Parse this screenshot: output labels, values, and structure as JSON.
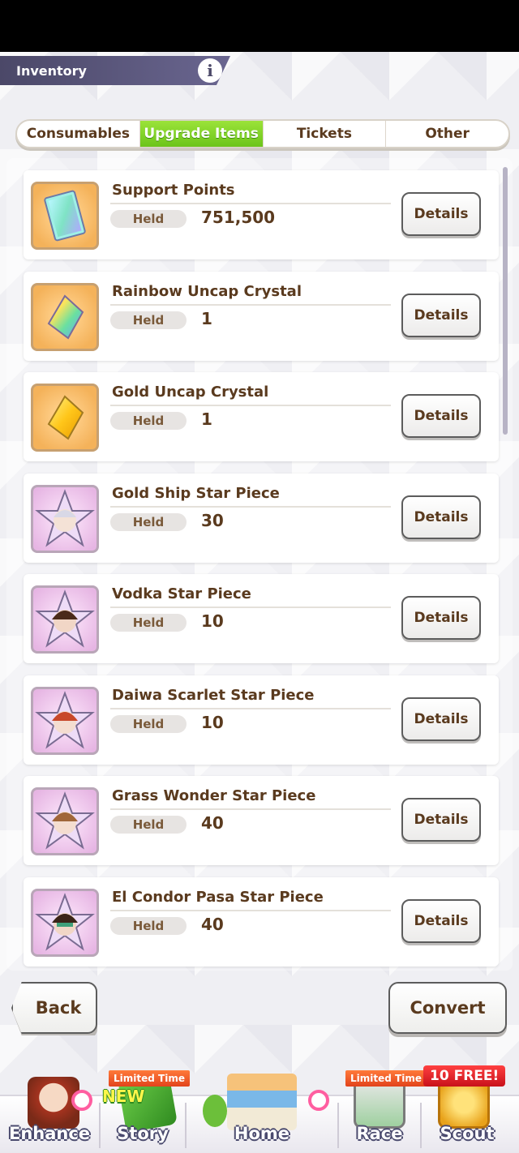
{
  "header": {
    "title": "Inventory",
    "info_icon": "info-icon"
  },
  "tabs": [
    {
      "label": "Consumables",
      "active": false
    },
    {
      "label": "Upgrade Items",
      "active": true
    },
    {
      "label": "Tickets",
      "active": false
    },
    {
      "label": "Other",
      "active": false
    }
  ],
  "items": [
    {
      "name": "Support Points",
      "held_label": "Held",
      "held_value": "751,500",
      "details_label": "Details",
      "icon": "support-card-icon"
    },
    {
      "name": "Rainbow Uncap Crystal",
      "held_label": "Held",
      "held_value": "1",
      "details_label": "Details",
      "icon": "rainbow-crystal-icon"
    },
    {
      "name": "Gold Uncap Crystal",
      "held_label": "Held",
      "held_value": "1",
      "details_label": "Details",
      "icon": "gold-crystal-icon"
    },
    {
      "name": "Gold Ship Star Piece",
      "held_label": "Held",
      "held_value": "30",
      "details_label": "Details",
      "icon": "star-piece-icon"
    },
    {
      "name": "Vodka Star Piece",
      "held_label": "Held",
      "held_value": "10",
      "details_label": "Details",
      "icon": "star-piece-icon"
    },
    {
      "name": "Daiwa Scarlet Star Piece",
      "held_label": "Held",
      "held_value": "10",
      "details_label": "Details",
      "icon": "star-piece-icon"
    },
    {
      "name": "Grass Wonder Star Piece",
      "held_label": "Held",
      "held_value": "40",
      "details_label": "Details",
      "icon": "star-piece-icon"
    },
    {
      "name": "El Condor Pasa Star Piece",
      "held_label": "Held",
      "held_value": "40",
      "details_label": "Details",
      "icon": "star-piece-icon"
    }
  ],
  "buttons": {
    "back": "Back",
    "convert": "Convert"
  },
  "nav": {
    "enhance": "Enhance",
    "story": "Story",
    "story_ribbon": "Limited Time",
    "story_new": "NEW",
    "home": "Home",
    "race": "Race",
    "race_ribbon": "Limited Time",
    "scout": "Scout",
    "scout_badge": "10 FREE!"
  },
  "colors": {
    "active_tab": "#7ed321",
    "text_brown": "#5a3a1e",
    "header_bg": "#4b4868"
  }
}
